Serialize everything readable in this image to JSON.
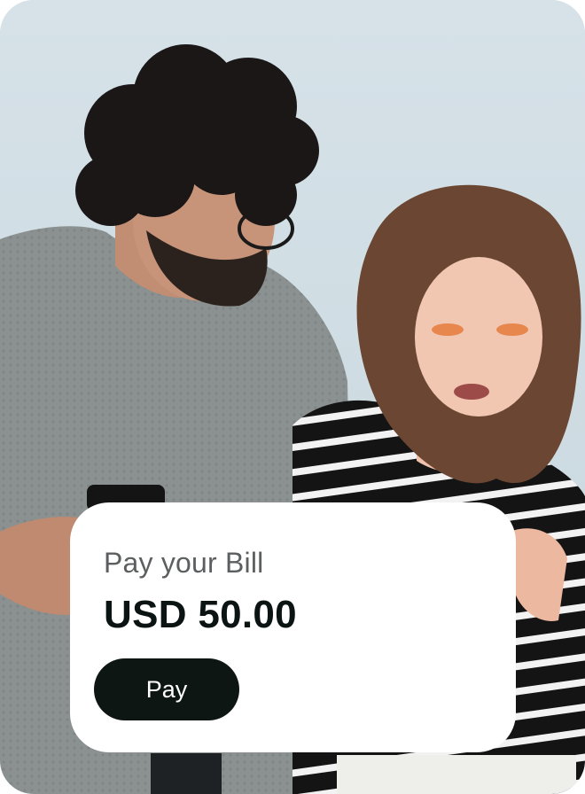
{
  "colors": {
    "background": "#cfdde3",
    "card": "#ffffff",
    "label_text": "#5c5f60",
    "amount_text": "#0b1412",
    "button_bg": "#0e1614",
    "button_text": "#ffffff"
  },
  "photo": {
    "subject": "man in grey sweater and woman in black-and-white striped top looking at phones"
  },
  "bill_card": {
    "label": "Pay your Bill",
    "amount": "USD 50.00",
    "pay_button_label": "Pay"
  }
}
